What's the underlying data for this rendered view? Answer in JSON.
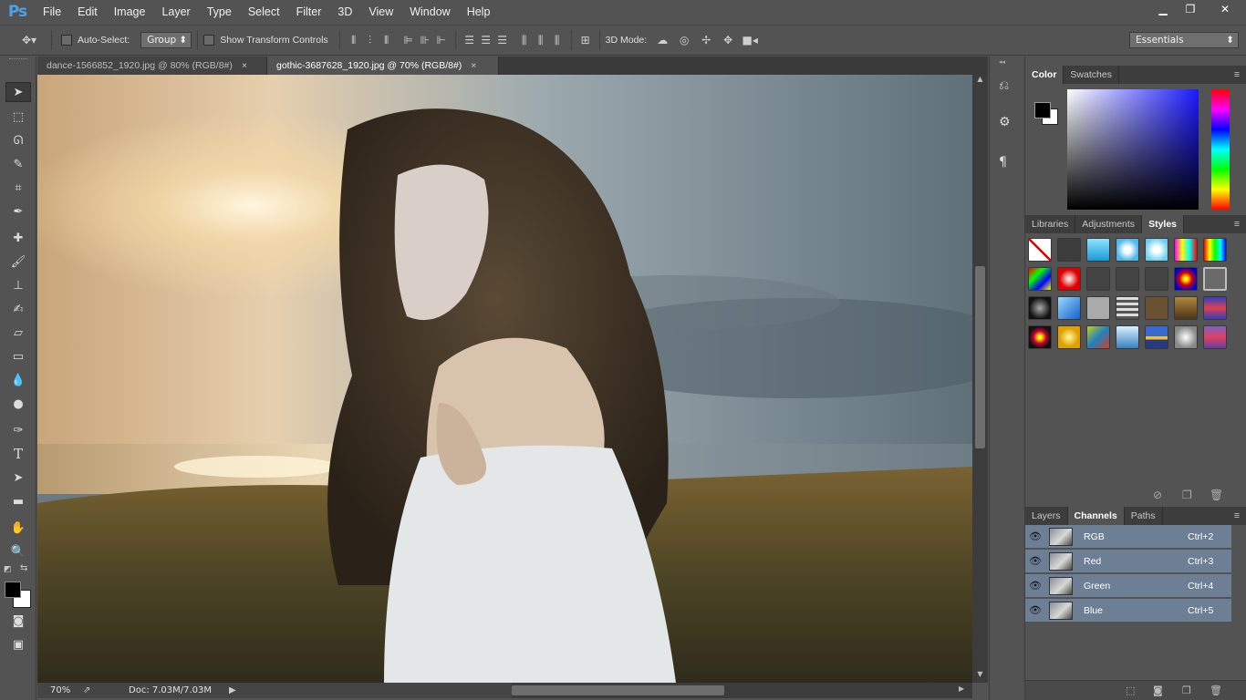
{
  "app": {
    "logo": "Ps"
  },
  "menu": [
    "File",
    "Edit",
    "Image",
    "Layer",
    "Type",
    "Select",
    "Filter",
    "3D",
    "View",
    "Window",
    "Help"
  ],
  "window_controls": {
    "minimize": "▁",
    "restore": "❐",
    "close": "✕"
  },
  "options": {
    "auto_select_label": "Auto-Select:",
    "auto_select_value": "Group",
    "show_transform_label": "Show Transform Controls",
    "mode_3d_label": "3D Mode:",
    "workspace": "Essentials"
  },
  "doc_tabs": [
    {
      "title": "dance-1566852_1920.jpg @ 80% (RGB/8#)",
      "close": "×",
      "active": false
    },
    {
      "title": "gothic-3687628_1920.jpg @ 70% (RGB/8#)",
      "close": "×",
      "active": true
    }
  ],
  "status": {
    "zoom": "70%",
    "doc": "Doc: 7.03M/7.03M",
    "arrow": "▶"
  },
  "color_panel": {
    "tabs": [
      "Color",
      "Swatches"
    ],
    "active": "Color",
    "foreground": "#000000",
    "background": "#ffffff"
  },
  "styles_panel": {
    "tabs": [
      "Libraries",
      "Adjustments",
      "Styles"
    ],
    "active": "Styles"
  },
  "layers_panel": {
    "tabs": [
      "Layers",
      "Channels",
      "Paths"
    ],
    "active": "Channels",
    "channels": [
      {
        "name": "RGB",
        "shortcut": "Ctrl+2"
      },
      {
        "name": "Red",
        "shortcut": "Ctrl+3"
      },
      {
        "name": "Green",
        "shortcut": "Ctrl+4"
      },
      {
        "name": "Blue",
        "shortcut": "Ctrl+5"
      }
    ]
  },
  "colors": {
    "accent": "#4aa3e8",
    "panel_bg": "#535353",
    "selected_row": "#6d7f95"
  }
}
